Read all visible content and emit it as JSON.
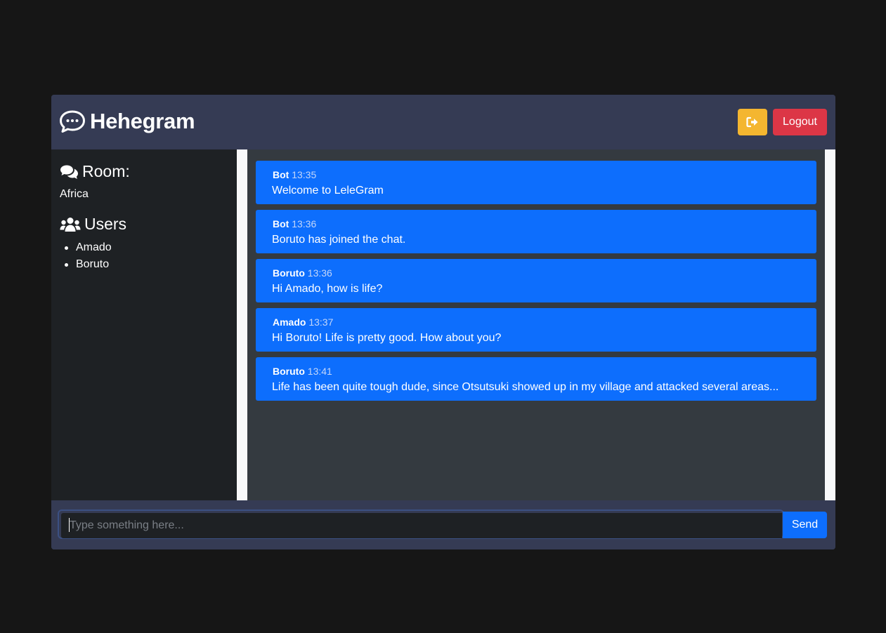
{
  "header": {
    "brand_icon": "chat-bubble-dots-icon",
    "title": "Hehegram",
    "exit_icon": "sign-out-icon",
    "logout_label": "Logout"
  },
  "sidebar": {
    "room_icon": "comments-icon",
    "room_heading": "Room:",
    "room_name": "Africa",
    "users_icon": "users-icon",
    "users_heading": "Users",
    "users": [
      "Amado",
      "Boruto"
    ]
  },
  "messages": [
    {
      "user": "Bot",
      "time": "13:35",
      "text": "Welcome to LeleGram"
    },
    {
      "user": "Bot",
      "time": "13:36",
      "text": "Boruto has joined the chat."
    },
    {
      "user": "Boruto",
      "time": "13:36",
      "text": "Hi Amado, how is life?"
    },
    {
      "user": "Amado",
      "time": "13:37",
      "text": "Hi Boruto! Life is pretty good. How about you?"
    },
    {
      "user": "Boruto",
      "time": "13:41",
      "text": "Life has been quite tough dude, since Otsutsuki showed up in my village and attacked several areas..."
    }
  ],
  "composer": {
    "placeholder": "Type something here...",
    "value": "",
    "send_label": "Send"
  },
  "colors": {
    "page_background": "#161616",
    "header_background": "#353b54",
    "sidebar_background": "#1e2124",
    "chat_background": "#343a40",
    "message_background": "#0d6efd",
    "exit_button": "#f4b630",
    "logout_button": "#dc3646",
    "send_button": "#0d6efd"
  }
}
